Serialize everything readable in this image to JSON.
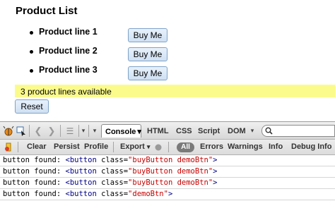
{
  "page": {
    "title": "Product List",
    "products": [
      {
        "label": "Product line 1",
        "button": "Buy Me"
      },
      {
        "label": "Product line 2",
        "button": "Buy Me"
      },
      {
        "label": "Product line 3",
        "button": "Buy Me"
      }
    ],
    "status": "3 product lines available",
    "reset_label": "Reset",
    "status_color": "#fbfb8c"
  },
  "firebug": {
    "tabs": [
      "Console",
      "HTML",
      "CSS",
      "Script",
      "DOM"
    ],
    "console_arrow": "▾",
    "toolbar2": {
      "clear": "Clear",
      "persist": "Persist",
      "profile": "Profile",
      "export": "Export",
      "export_arrow": "▾",
      "all": "All",
      "errors": "Errors",
      "warnings": "Warnings",
      "info": "Info",
      "debug_info": "Debug Info"
    },
    "icons": [
      "firebug-icon",
      "inspect-icon",
      "back-icon",
      "forward-icon",
      "list-icon",
      "menu-arrow-icon",
      "search-icon",
      "clear-console-icon",
      "record-icon"
    ],
    "log": [
      {
        "prefix": "button found:",
        "tag_open": "<button",
        "attr": "class=",
        "value": "\"buyButton demoBtn\"",
        "tag_close": ">"
      },
      {
        "prefix": "button found:",
        "tag_open": "<button",
        "attr": "class=",
        "value": "\"buyButton demoBtn\"",
        "tag_close": ">"
      },
      {
        "prefix": "button found:",
        "tag_open": "<button",
        "attr": "class=",
        "value": "\"buyButton demoBtn\"",
        "tag_close": ">"
      },
      {
        "prefix": "button found:",
        "tag_open": "<button",
        "attr": "class=",
        "value": "\"demoBtn\"",
        "tag_close": ">"
      }
    ]
  }
}
